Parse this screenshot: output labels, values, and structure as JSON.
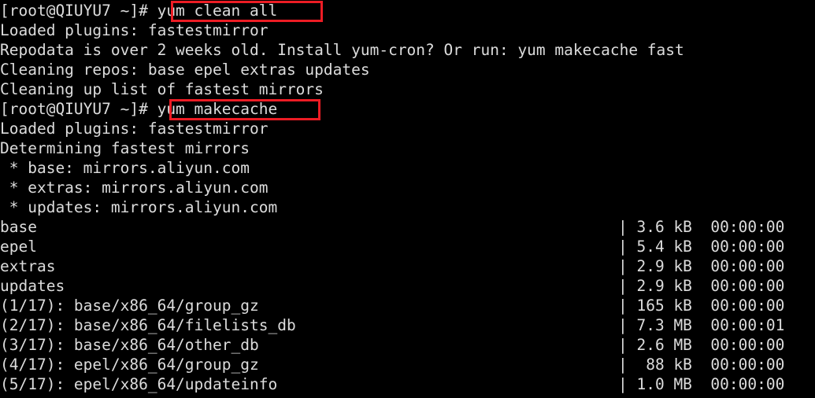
{
  "terminal": {
    "background_color": "#000000",
    "text_color": "#dcdcdc",
    "highlight_color": "#ec1c24",
    "prompt": "[root@QIUYU7 ~]#",
    "hostname": "QIUYU7",
    "user": "root",
    "cwd": "~",
    "commands": [
      {
        "id": "clean-all",
        "text": "yum clean all",
        "highlighted": true
      },
      {
        "id": "makecache",
        "text": "yum makecache",
        "highlighted": true
      }
    ],
    "lines": [
      {
        "left": "[root@QIUYU7 ~]# yum clean all",
        "meter": ""
      },
      {
        "left": "Loaded plugins: fastestmirror",
        "meter": ""
      },
      {
        "left": "Repodata is over 2 weeks old. Install yum-cron? Or run: yum makecache fast",
        "meter": ""
      },
      {
        "left": "Cleaning repos: base epel extras updates",
        "meter": ""
      },
      {
        "left": "Cleaning up list of fastest mirrors",
        "meter": ""
      },
      {
        "left": "[root@QIUYU7 ~]# yum makecache",
        "meter": ""
      },
      {
        "left": "Loaded plugins: fastestmirror",
        "meter": ""
      },
      {
        "left": "Determining fastest mirrors",
        "meter": ""
      },
      {
        "left": " * base: mirrors.aliyun.com",
        "meter": ""
      },
      {
        "left": " * extras: mirrors.aliyun.com",
        "meter": ""
      },
      {
        "left": " * updates: mirrors.aliyun.com",
        "meter": ""
      },
      {
        "left": "base",
        "meter": "| 3.6 kB  00:00:00"
      },
      {
        "left": "epel",
        "meter": "| 5.4 kB  00:00:00"
      },
      {
        "left": "extras",
        "meter": "| 2.9 kB  00:00:00"
      },
      {
        "left": "updates",
        "meter": "| 2.9 kB  00:00:00"
      },
      {
        "left": "(1/17): base/x86_64/group_gz",
        "meter": "| 165 kB  00:00:00"
      },
      {
        "left": "(2/17): base/x86_64/filelists_db",
        "meter": "| 7.3 MB  00:00:01"
      },
      {
        "left": "(3/17): base/x86_64/other_db",
        "meter": "| 2.6 MB  00:00:00"
      },
      {
        "left": "(4/17): epel/x86_64/group_gz",
        "meter": "|  88 kB  00:00:00"
      },
      {
        "left": "(5/17): epel/x86_64/updateinfo",
        "meter": "| 1.0 MB  00:00:00"
      }
    ],
    "downloads": [
      {
        "index": "(1/17)",
        "path": "base/x86_64/group_gz",
        "size": "165 kB",
        "time": "00:00:00"
      },
      {
        "index": "(2/17)",
        "path": "base/x86_64/filelists_db",
        "size": "7.3 MB",
        "time": "00:00:01"
      },
      {
        "index": "(3/17)",
        "path": "base/x86_64/other_db",
        "size": "2.6 MB",
        "time": "00:00:00"
      },
      {
        "index": "(4/17)",
        "path": "epel/x86_64/group_gz",
        "size": "88 kB",
        "time": "00:00:00"
      },
      {
        "index": "(5/17)",
        "path": "epel/x86_64/updateinfo",
        "size": "1.0 MB",
        "time": "00:00:00"
      }
    ],
    "repos": [
      {
        "name": "base",
        "size": "3.6 kB",
        "time": "00:00:00"
      },
      {
        "name": "epel",
        "size": "5.4 kB",
        "time": "00:00:00"
      },
      {
        "name": "extras",
        "size": "2.9 kB",
        "time": "00:00:00"
      },
      {
        "name": "updates",
        "size": "2.9 kB",
        "time": "00:00:00"
      }
    ],
    "mirrors": [
      {
        "repo": "base",
        "host": "mirrors.aliyun.com"
      },
      {
        "repo": "extras",
        "host": "mirrors.aliyun.com"
      },
      {
        "repo": "updates",
        "host": "mirrors.aliyun.com"
      }
    ]
  }
}
